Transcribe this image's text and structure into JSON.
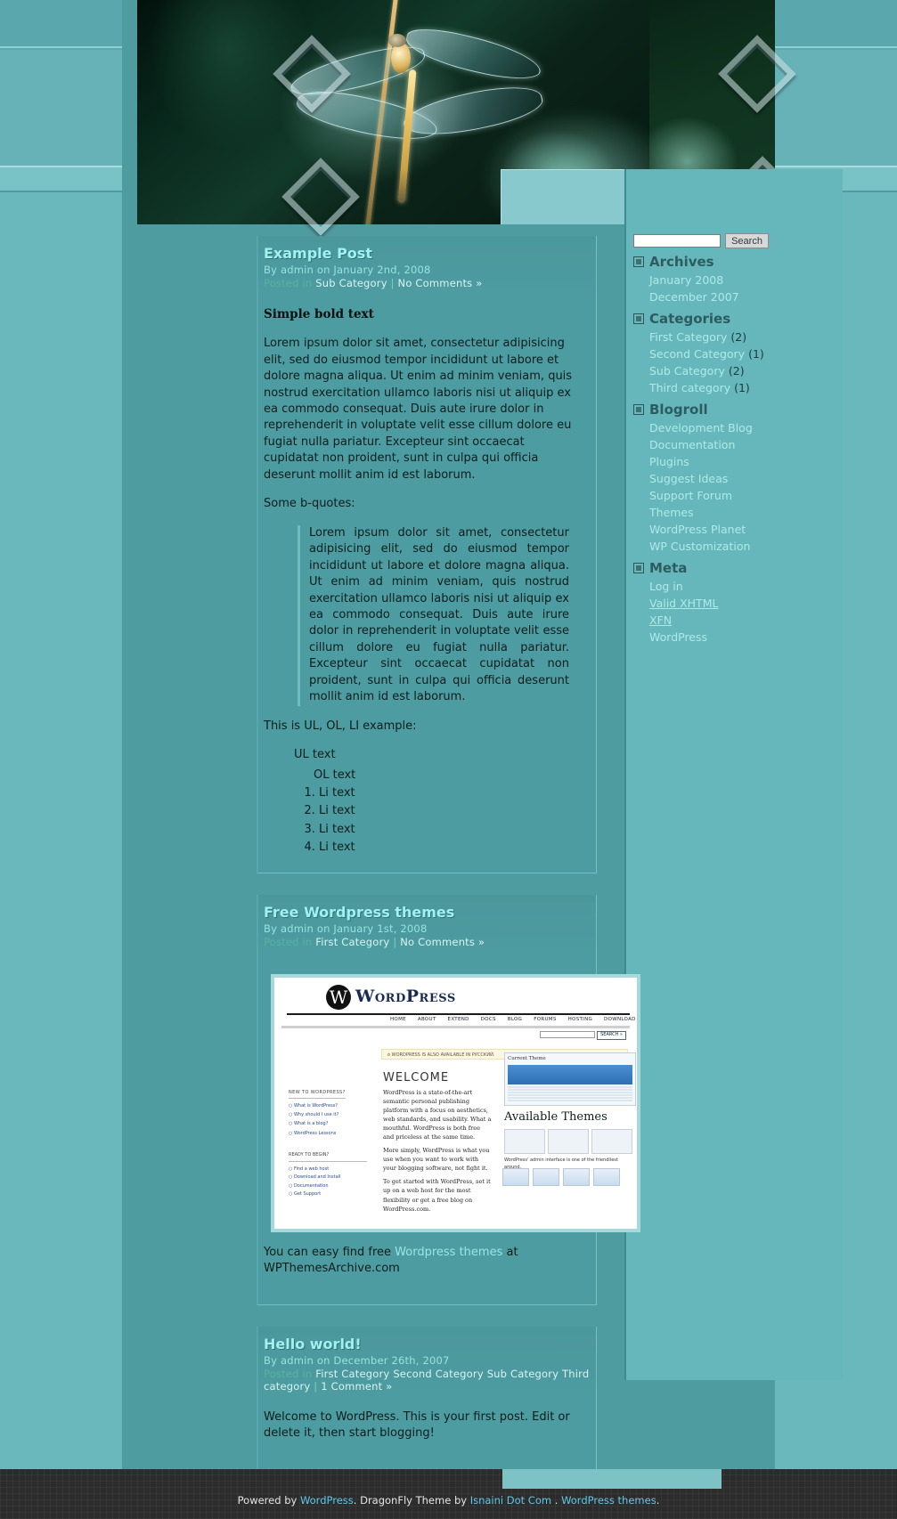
{
  "site": {
    "header_image_alt": "dragonfly-header-photo"
  },
  "sidebar": {
    "search": {
      "value": "",
      "placeholder": "",
      "button_label": "Search"
    },
    "widgets": [
      {
        "title": "Archives",
        "items": [
          {
            "label": "January 2008",
            "count": ""
          },
          {
            "label": "December 2007",
            "count": ""
          }
        ]
      },
      {
        "title": "Categories",
        "items": [
          {
            "label": "First Category",
            "count": "(2)"
          },
          {
            "label": "Second Category",
            "count": "(1)"
          },
          {
            "label": "Sub Category",
            "count": "(2)"
          },
          {
            "label": "Third category",
            "count": "(1)"
          }
        ]
      },
      {
        "title": "Blogroll",
        "items": [
          {
            "label": "Development Blog",
            "count": ""
          },
          {
            "label": "Documentation",
            "count": ""
          },
          {
            "label": "Plugins",
            "count": ""
          },
          {
            "label": "Suggest Ideas",
            "count": ""
          },
          {
            "label": "Support Forum",
            "count": ""
          },
          {
            "label": "Themes",
            "count": ""
          },
          {
            "label": "WordPress Planet",
            "count": ""
          },
          {
            "label": "WP Customization",
            "count": ""
          }
        ]
      },
      {
        "title": "Meta",
        "items": [
          {
            "label": "Log in",
            "count": ""
          },
          {
            "label": "Valid XHTML",
            "count": ""
          },
          {
            "label": "XFN",
            "count": ""
          },
          {
            "label": "WordPress",
            "count": ""
          }
        ]
      }
    ]
  },
  "posts": [
    {
      "title": "Example Post",
      "byline": "By admin on January 2nd, 2008",
      "posted_label": "Posted in",
      "categories": [
        "Sub Category"
      ],
      "comments": "No Comments »",
      "bold_heading": "Simple bold text",
      "paragraph1": "Lorem ipsum dolor sit amet, consectetur adipisicing elit, sed do eiusmod tempor incididunt ut labore et dolore magna aliqua. Ut enim ad minim veniam, quis nostrud exercitation ullamco laboris nisi ut aliquip ex ea commodo consequat. Duis aute irure dolor in reprehenderit in voluptate velit esse cillum dolore eu fugiat nulla pariatur. Excepteur sint occaecat cupidatat non proident, sunt in culpa qui officia deserunt mollit anim id est laborum.",
      "quote_intro": "Some b-quotes:",
      "blockquote": "Lorem ipsum dolor sit amet, consectetur adipisicing elit, sed do eiusmod tempor incididunt ut labore et dolore magna aliqua. Ut enim ad minim veniam, quis nostrud exercitation ullamco laboris nisi ut aliquip ex ea commodo consequat. Duis aute irure dolor in reprehenderit in voluptate velit esse cillum dolore eu fugiat nulla pariatur. Excepteur sint occaecat cupidatat non proident, sunt in culpa qui officia deserunt mollit anim id est laborum.",
      "list_intro": "This is UL, OL, LI example:",
      "ul_text": "UL text",
      "ol_text": "OL text",
      "li_items": [
        "Li text",
        "Li text",
        "Li text",
        "Li text"
      ]
    },
    {
      "title": "Free Wordpress themes",
      "byline": "By admin on January 1st, 2008",
      "posted_label": "Posted in",
      "categories": [
        "First Category"
      ],
      "comments": "No Comments »",
      "image_name": "wordpress-org-screenshot",
      "body_before_link": "You can easy find free ",
      "body_link": "Wordpress themes",
      "body_after_link": " at WPThemesArchive.com"
    },
    {
      "title": "Hello world!",
      "byline": "By admin on December 26th, 2007",
      "posted_label": "Posted in",
      "categories": [
        "First Category",
        "Second Category",
        "Sub Category",
        "Third category"
      ],
      "comments": "1 Comment »",
      "body": "Welcome to WordPress. This is your first post. Edit or delete it, then start blogging!"
    }
  ],
  "wp_shot": {
    "logo": "WordPress",
    "nav": [
      "HOME",
      "ABOUT",
      "EXTEND",
      "DOCS",
      "BLOG",
      "FORUMS",
      "HOSTING",
      "DOWNLOAD"
    ],
    "search_button": "SEARCH »",
    "notice": "ò WORDPRESS IS ALSO AVAILABLE IN РУССКИЙ.",
    "welcome": "WELCOME",
    "col1_heading": "NEW TO WORDPRESS?",
    "col1_items": [
      "○ What is WordPress?",
      "○ Why should I use it?",
      "○ What is a blog?",
      "○ WordPress Lessons"
    ],
    "col2_p1": "WordPress is a state-of-the-art semantic personal publishing platform with a focus on aesthetics, web standards, and usability. What a mouthful. WordPress is both free and priceless at the same time.",
    "col2_p2": "More simply, WordPress is what you use when you want to work with your blogging software, not fight it.",
    "col2_p3": "To get started with WordPress, set it up on a web host for the most flexibility or get a free blog on WordPress.com.",
    "card_title": "Current Theme",
    "card_sub": "Available Themes",
    "card_caption": "WordPress' admin interface is one of the friendliest around.",
    "bottom_heading": "READY TO BEGIN?",
    "bottom_items": [
      "○ Find a web host",
      "○ Download and Install",
      "○ Documentation",
      "○ Get Support"
    ]
  },
  "footer": {
    "powered_by": "Powered by ",
    "wordpress": "WordPress",
    "theme_text": ". DragonFly Theme by ",
    "author": "Isnaini Dot Com",
    "sep": " . ",
    "themes_link": "WordPress themes",
    "end": "."
  },
  "colors": {
    "page_bg": "#6bb8bc",
    "post_bg": "#4d9ca1",
    "title": "#9ff2f2",
    "link": "#aeeae6",
    "footer_bg": "#2c2c2c",
    "footer_link": "#5ec8e8"
  }
}
